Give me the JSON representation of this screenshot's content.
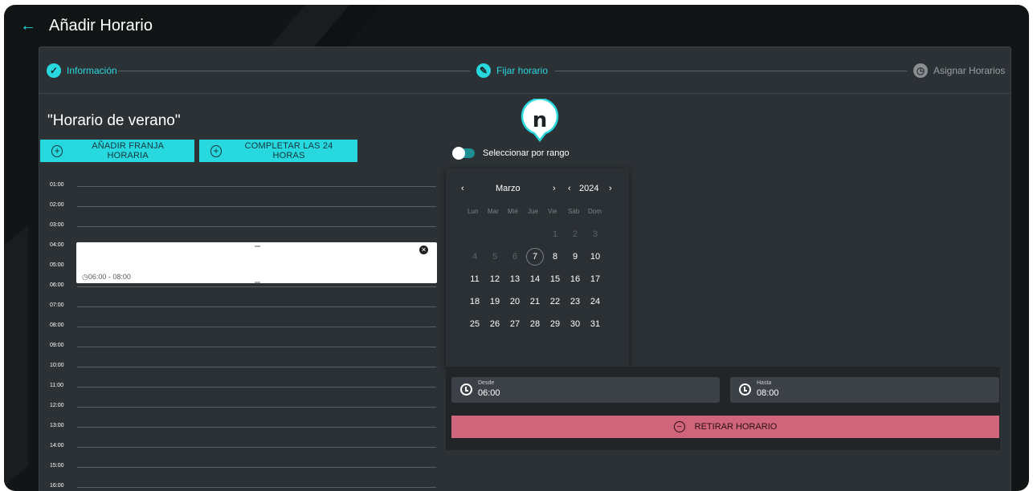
{
  "header": {
    "back_icon": "arrow-left-icon",
    "title": "Añadir Horario"
  },
  "stepper": {
    "steps": [
      {
        "label": "Información",
        "state": "done",
        "icon": "check-icon"
      },
      {
        "label": "Fijar horario",
        "state": "active",
        "icon": "pencil-icon"
      },
      {
        "label": "Asignar Horarios",
        "state": "pending",
        "icon": "clock-icon"
      }
    ]
  },
  "schedule": {
    "title": "\"Horario de verano\""
  },
  "actions": {
    "add_slot": "AÑADIR FRANJA HORARIA",
    "fill_24": "COMPLETAR LAS 24 HORAS"
  },
  "timeline": {
    "hours": [
      "01:00",
      "02:00",
      "03:00",
      "04:00",
      "05:00",
      "06:00",
      "07:00",
      "08:00",
      "09:00",
      "10:00",
      "11:00",
      "12:00",
      "13:00",
      "14:00",
      "15:00",
      "16:00"
    ],
    "slot": {
      "label": "06:00 - 08:00",
      "start": "06:00",
      "end": "08:00"
    }
  },
  "marker": {
    "letter": "n"
  },
  "range_toggle": {
    "label": "Seleccionar por rango",
    "checked": false
  },
  "calendar": {
    "month": "Marzo",
    "year": "2024",
    "prev_month": "‹",
    "next_month": "›",
    "prev_year": "‹",
    "next_year": "›",
    "weekdays": [
      "Lun",
      "Mar",
      "Mié",
      "Jue",
      "Vie",
      "Sáb",
      "Dom"
    ],
    "days": [
      [
        "",
        "",
        "",
        "",
        "1",
        "2",
        "3"
      ],
      [
        "4",
        "5",
        "6",
        "7",
        "8",
        "9",
        "10"
      ],
      [
        "11",
        "12",
        "13",
        "14",
        "15",
        "16",
        "17"
      ],
      [
        "18",
        "19",
        "20",
        "21",
        "22",
        "23",
        "24"
      ],
      [
        "25",
        "26",
        "27",
        "28",
        "29",
        "30",
        "31"
      ]
    ],
    "today": "7"
  },
  "slot_editor": {
    "from_label": "Desde",
    "from_value": "06:00",
    "to_label": "Hasta",
    "to_value": "08:00",
    "remove_button": "RETIRAR HORARIO"
  },
  "colors": {
    "accent": "#27d9df",
    "danger": "#d0647a",
    "panel": "#2c3135",
    "frame": "#121516"
  }
}
